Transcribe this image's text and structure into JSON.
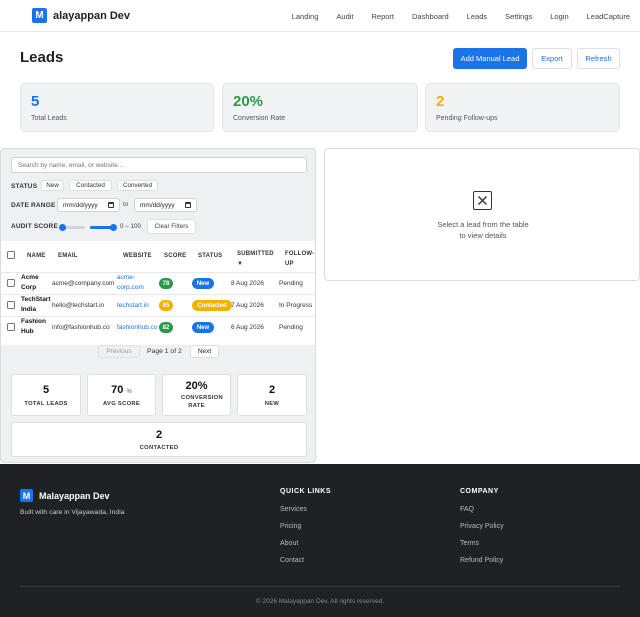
{
  "header": {
    "logo_letter": "M",
    "brand": "alayappan Dev",
    "nav": [
      "Landing",
      "Audit",
      "Report",
      "Dashboard",
      "Leads",
      "Settings",
      "Login",
      "LeadCapture"
    ]
  },
  "page": {
    "title": "Leads",
    "add_button": "Add Manual Lead",
    "export_button": "Export",
    "refresh_button": "Refresh"
  },
  "stats": [
    {
      "value": "5",
      "label": "Total Leads",
      "color": "#1a73e8"
    },
    {
      "value": "20%",
      "label": "Conversion Rate",
      "color": "#2a9a4a"
    },
    {
      "value": "2",
      "label": "Pending Follow-ups",
      "color": "#f2b200"
    }
  ],
  "filters": {
    "search_placeholder": "Search by name, email, or website...",
    "status_label": "STATUS",
    "status_chips": [
      "New",
      "Contacted",
      "Converted"
    ],
    "date_label": "DATE RANGE",
    "date_from": "mm/dd/yyyy",
    "date_to_text": "to",
    "date_to": "mm/dd/yyyy",
    "audit_label": "AUDIT SCORE",
    "audit_range": "0 – 100",
    "clear_button": "Clear Filters"
  },
  "table": {
    "headers": [
      "NAME",
      "EMAIL",
      "WEBSITE",
      "SCORE",
      "STATUS",
      "SUBMITTED ▼",
      "FOLLOW-UP"
    ],
    "rows": [
      {
        "name": "Acme Corp",
        "email": "acme@company.com",
        "website": "acme-corp.com",
        "score": "78",
        "score_color": "#2a9a4a",
        "status": "New",
        "status_color": "#1a73e8",
        "submitted": "8 Aug 2026",
        "followup": "Pending"
      },
      {
        "name": "TechStart India",
        "email": "hello@techstart.in",
        "website": "techstart.in",
        "score": "65",
        "score_color": "#f2b200",
        "status": "Contacted",
        "status_color": "#f2b200",
        "submitted": "7 Aug 2026",
        "followup": "In Progress"
      },
      {
        "name": "Fashion Hub",
        "email": "info@fashionhub.co",
        "website": "fashionhub.co",
        "score": "82",
        "score_color": "#2a9a4a",
        "status": "New",
        "status_color": "#1a73e8",
        "submitted": "6 Aug 2026",
        "followup": "Pending"
      }
    ]
  },
  "pagination": {
    "prev": "Previous",
    "page_text": "Page 1 of 2",
    "next": "Next"
  },
  "summary": {
    "total_leads": {
      "value": "5",
      "label": "TOTAL LEADS"
    },
    "avg_score": {
      "value": "70",
      "unit": "%",
      "label": "AVG SCORE"
    },
    "conversion": {
      "value": "20%",
      "label": "CONVERSION RATE"
    },
    "new": {
      "value": "2",
      "label": "NEW"
    },
    "contacted": {
      "value": "2",
      "label": "CONTACTED"
    }
  },
  "detail": {
    "empty_line1": "Select a lead from the table",
    "empty_line2": "to view details"
  },
  "footer": {
    "brand": "Malayappan Dev",
    "tagline": "Built with care in Vijayawada, India",
    "quick_links_title": "QUICK LINKS",
    "quick_links": [
      "Services",
      "Pricing",
      "About",
      "Contact"
    ],
    "company_title": "COMPANY",
    "company_links": [
      "FAQ",
      "Privacy Policy",
      "Terms",
      "Refund Policy"
    ],
    "copyright": "© 2026 Malayappan Dev. All rights reserved."
  }
}
